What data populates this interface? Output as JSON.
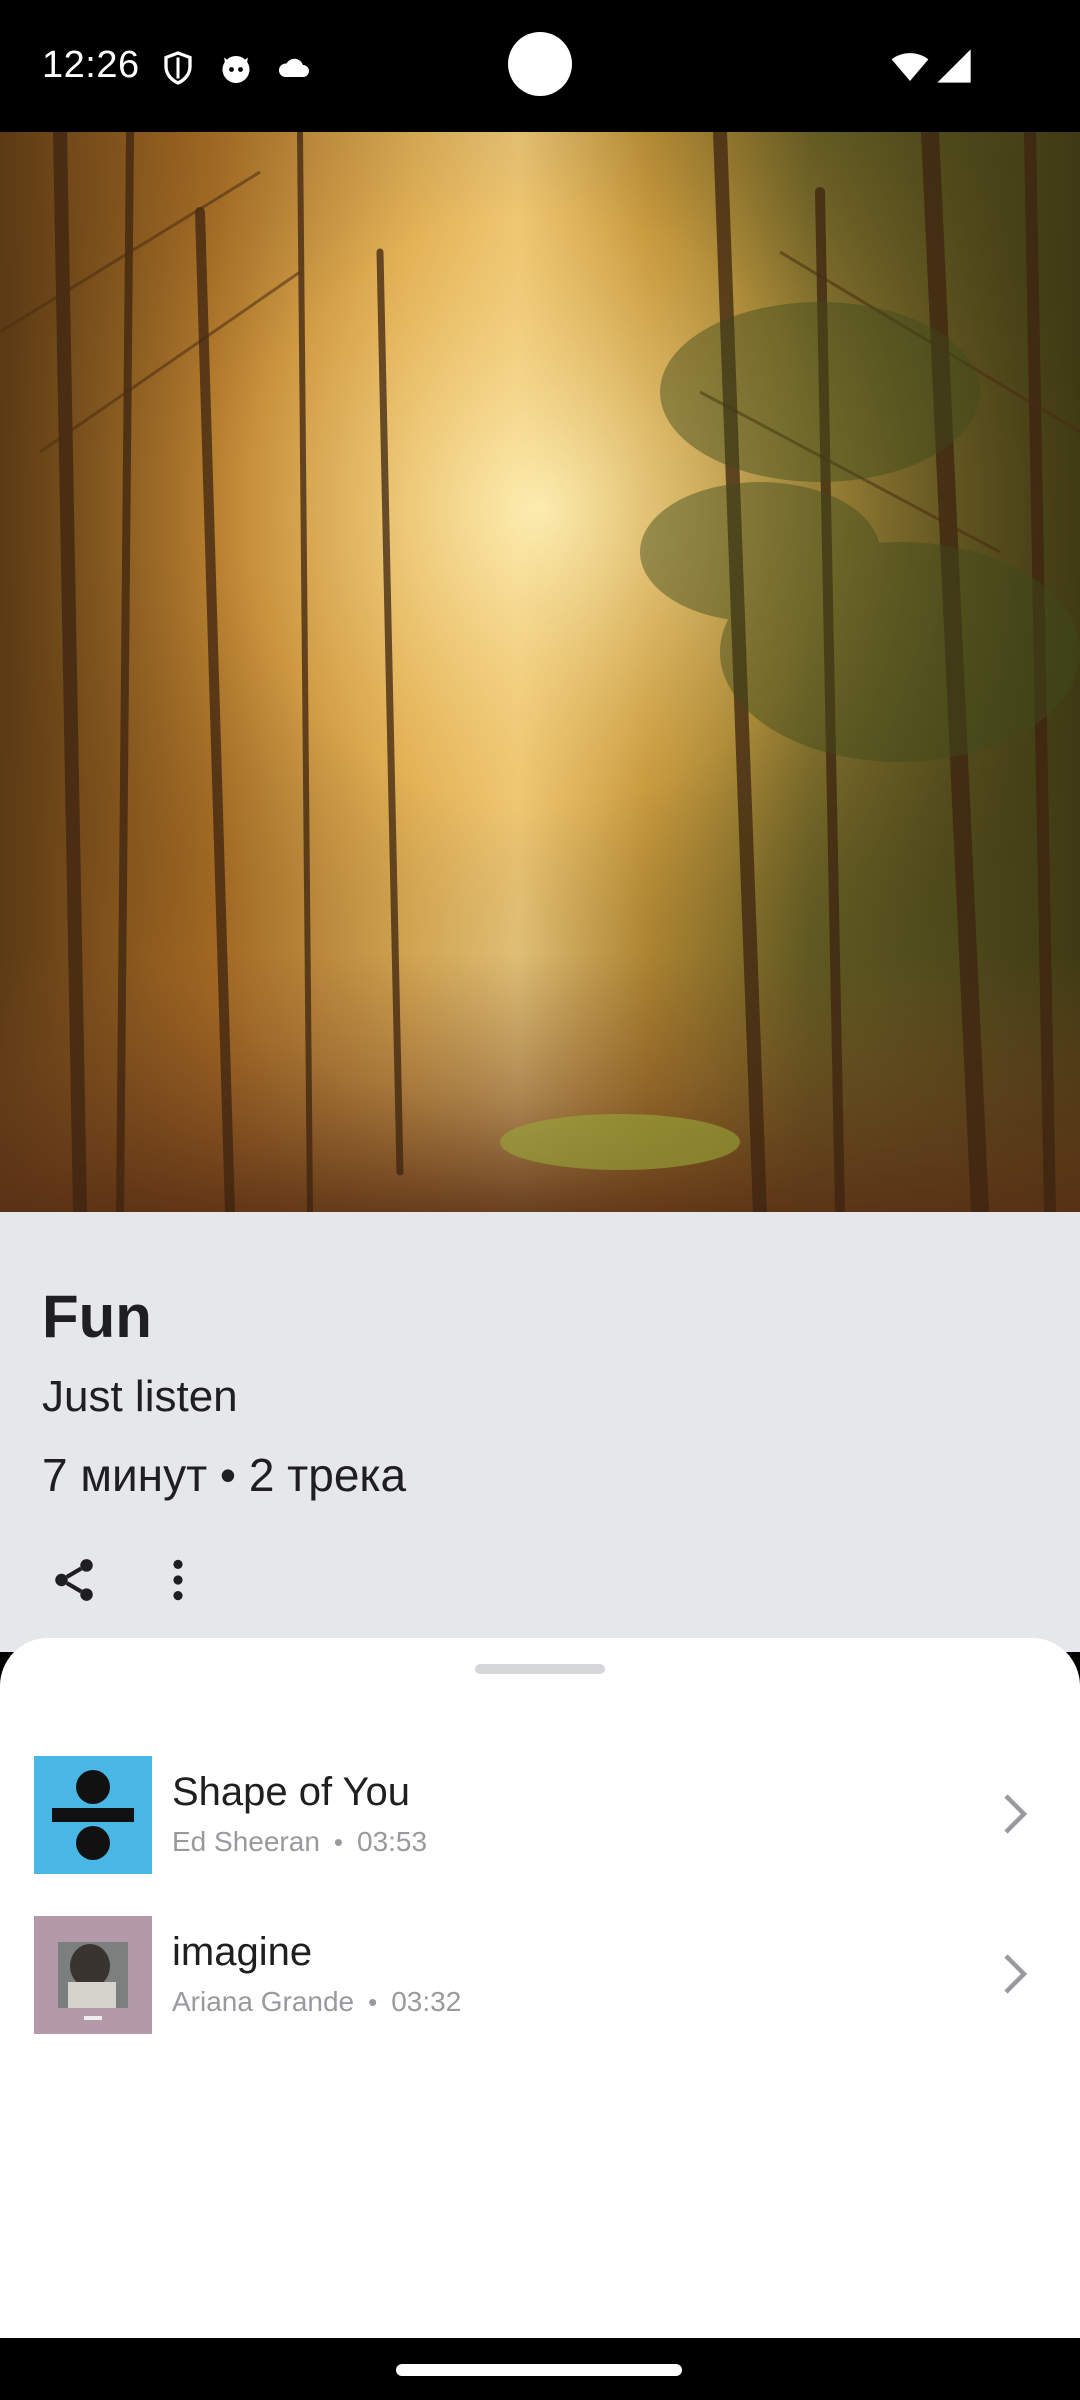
{
  "status_bar": {
    "time": "12:26",
    "icons": [
      "shield-icon",
      "cat-face-icon",
      "cloud-icon",
      "wifi-icon",
      "signal-icon"
    ]
  },
  "playlist": {
    "cover_image": "autumn-forest-path",
    "title": "Fun",
    "description": "Just listen",
    "meta": "7 минут • 2 трека",
    "actions": [
      "share-icon",
      "more-vertical-icon"
    ]
  },
  "tracks": [
    {
      "title": "Shape of You",
      "artist": "Ed Sheeran",
      "duration": "03:53",
      "cover": "divide-album-art"
    },
    {
      "title": "imagine",
      "artist": "Ariana Grande",
      "duration": "03:32",
      "cover": "thank-u-next-album-art"
    }
  ],
  "colors": {
    "panel_bg": "#e6e7ea",
    "sheet_bg": "#ffffff",
    "text_primary": "#1f1f22",
    "text_secondary": "#9a9a9e"
  }
}
